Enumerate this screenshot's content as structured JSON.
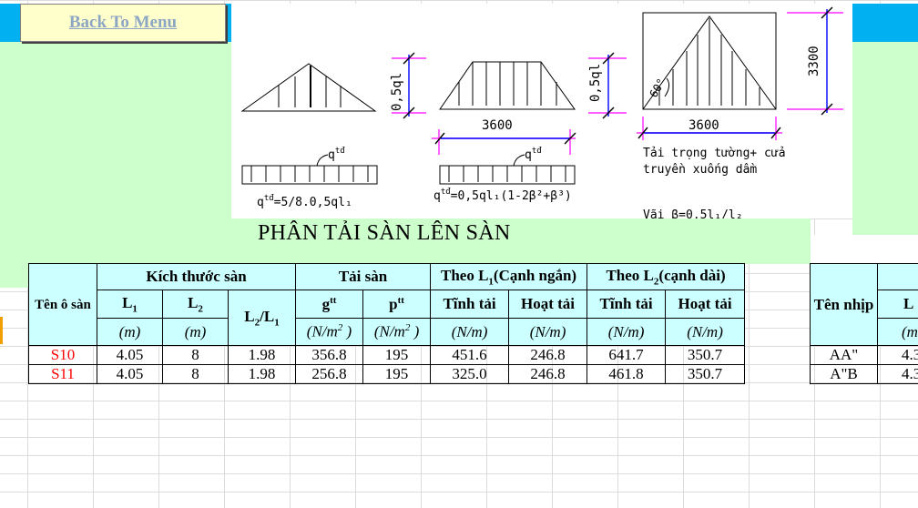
{
  "colors": {
    "cyan_band": "#00b0f0",
    "light_green": "#ccffcc",
    "header_bg": "#ccffff",
    "button_bg": "#ffffcc",
    "button_text": "#8da6c4",
    "red": "#ff0000",
    "magenta": "#ff00ff"
  },
  "button": {
    "label": "Back To Menu"
  },
  "title": "PHÂN TẢI SÀN LÊN SÀN",
  "diagram": {
    "label_05ql1_a": "0,5ql",
    "label_05ql1_b": "0,5ql",
    "dim_3600_a": "3600",
    "dim_3600_b": "3600",
    "dim_3300": "3300",
    "angle": "60°",
    "q_label": "q",
    "q_sup": "tđ",
    "formula_triangle": "q",
    "formula_triangle_rest": "=5/8.0,5ql₁",
    "formula_trap": "q",
    "formula_trap_rest": "=0,5ql₁(1-2β²+β³)",
    "wall_note_1": "Tải trọng tường+ cửa",
    "wall_note_2": "truyền xuống dầm",
    "beta_note": "Vãi β=0,5l₁/l₂"
  },
  "table": {
    "h_name": "Tên ô sàn",
    "h_size": "Kích thước sàn",
    "h_load": "Tải sàn",
    "h_l1": "Theo L",
    "h_l1_sub": "1",
    "h_l1_rest": "(Cạnh ngắn)",
    "h_l2": "Theo L",
    "h_l2_sub": "2",
    "h_l2_rest": "(cạnh dài)",
    "c_L": "L",
    "c_1": "1",
    "c_2": "2",
    "c_ratio_a": "L",
    "c_ratio_b": "/L",
    "c_g": "g",
    "c_p": "p",
    "c_tt": "tt",
    "c_tinh": "Tĩnh tải",
    "c_hoat": "Hoạt tải",
    "u_m": "(m)",
    "u_nm2_a": "(N/m",
    "u_nm2_sup": "2",
    "u_nm2_b": " )",
    "u_nm": "(N/m)",
    "rows": [
      {
        "name": "S10",
        "l1": "4.05",
        "l2": "8",
        "ratio": "1.98",
        "g": "356.8",
        "p": "195",
        "t1": "451.6",
        "h1": "246.8",
        "t2": "641.7",
        "h2": "350.7"
      },
      {
        "name": "S11",
        "l1": "4.05",
        "l2": "8",
        "ratio": "1.98",
        "g": "256.8",
        "p": "195",
        "t1": "325.0",
        "h1": "246.8",
        "t2": "461.8",
        "h2": "350.7"
      }
    ]
  },
  "table2": {
    "h_name": "Tên nhịp",
    "h_l": "L",
    "u_m": "(m",
    "rows": [
      {
        "name": "AA\"",
        "l": "4.3"
      },
      {
        "name": "A\"B",
        "l": "4.3"
      }
    ]
  }
}
